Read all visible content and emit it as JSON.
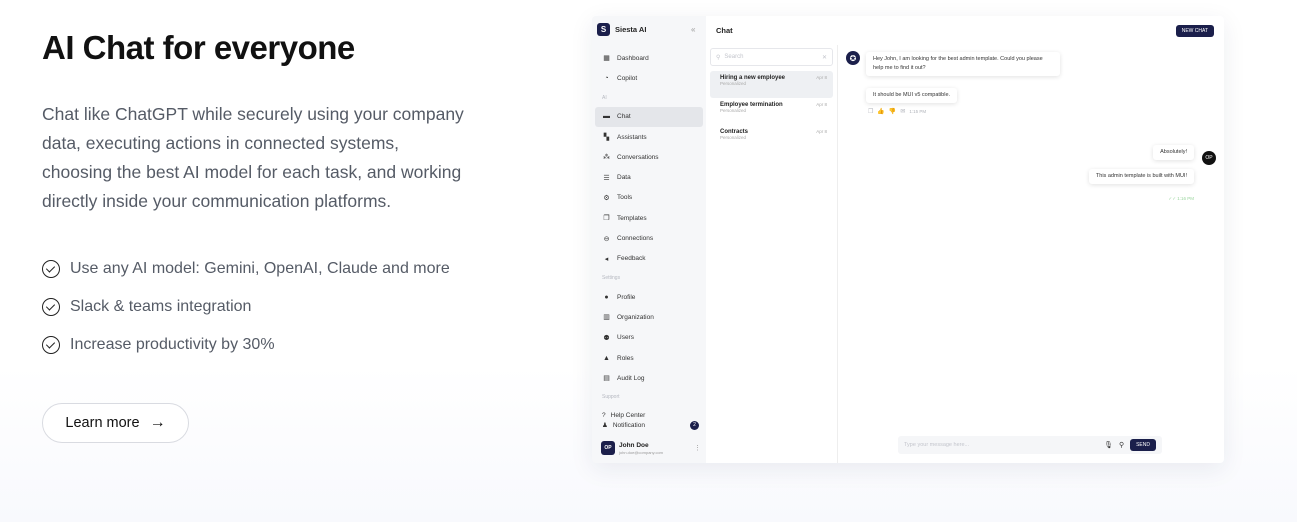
{
  "hero": {
    "title": "AI Chat for everyone",
    "lead": "Chat like ChatGPT while securely using your company data, executing actions in connected systems, choosing the best AI model for each task, and working directly inside your communication platforms.",
    "features": [
      "Use any AI model: Gemini, OpenAI, Claude and more",
      "Slack & teams integration",
      "Increase productivity by 30%"
    ],
    "cta_label": "Learn more",
    "cta_icon": "arrow-right-icon"
  },
  "app": {
    "brand_initial": "S",
    "brand_name": "Siesta AI",
    "nav": [
      {
        "label": "Dashboard",
        "icon": "dashboard-icon"
      },
      {
        "label": "Copilot",
        "icon": "copilot-icon"
      },
      {
        "section": "AI"
      },
      {
        "label": "Chat",
        "icon": "chat-icon",
        "active": true
      },
      {
        "label": "Assistants",
        "icon": "assistants-icon"
      },
      {
        "label": "Conversations",
        "icon": "conversations-icon"
      },
      {
        "label": "Data",
        "icon": "data-icon"
      },
      {
        "label": "Tools",
        "icon": "tools-icon"
      },
      {
        "label": "Templates",
        "icon": "templates-icon"
      },
      {
        "label": "Connections",
        "icon": "link-icon"
      },
      {
        "label": "Feedback",
        "icon": "feedback-icon"
      },
      {
        "section": "Settings"
      },
      {
        "label": "Profile",
        "icon": "profile-icon"
      },
      {
        "label": "Organization",
        "icon": "organization-icon"
      },
      {
        "label": "Users",
        "icon": "users-icon"
      },
      {
        "label": "Roles",
        "icon": "roles-icon"
      },
      {
        "label": "Audit Log",
        "icon": "audit-log-icon"
      },
      {
        "section": "Support"
      }
    ],
    "help_center": "Help Center",
    "notification": "Notification",
    "notification_count": "2",
    "user": {
      "initials": "OP",
      "name": "John Doe",
      "email": "john.doe@company.com"
    },
    "chat_title": "Chat",
    "new_chat": "NEW CHAT",
    "search_placeholder": "Search",
    "chats": [
      {
        "title": "Hiring a new employee",
        "sub": "Personalized",
        "date": "Apr 8",
        "active": true
      },
      {
        "title": "Employee termination",
        "sub": "Personalized",
        "date": "Apr 8"
      },
      {
        "title": "Contracts",
        "sub": "Personalized",
        "date": "Apr 8"
      }
    ],
    "messages": {
      "m1": "Hey John, I am looking for the best admin template. Could you please help me to find it out?",
      "m2": "It should be MUI v5 compatible.",
      "m2_time": "1:15 PM",
      "m3": "Absolutely!",
      "m4": "This admin template is built with MUI!",
      "m4_time": "1:16 PM",
      "user_initials": "OP"
    },
    "composer_placeholder": "Type your message here...",
    "send": "SEND"
  },
  "colors": {
    "brand": "#1b1f4b",
    "text": "#111111",
    "muted": "#555b66"
  }
}
